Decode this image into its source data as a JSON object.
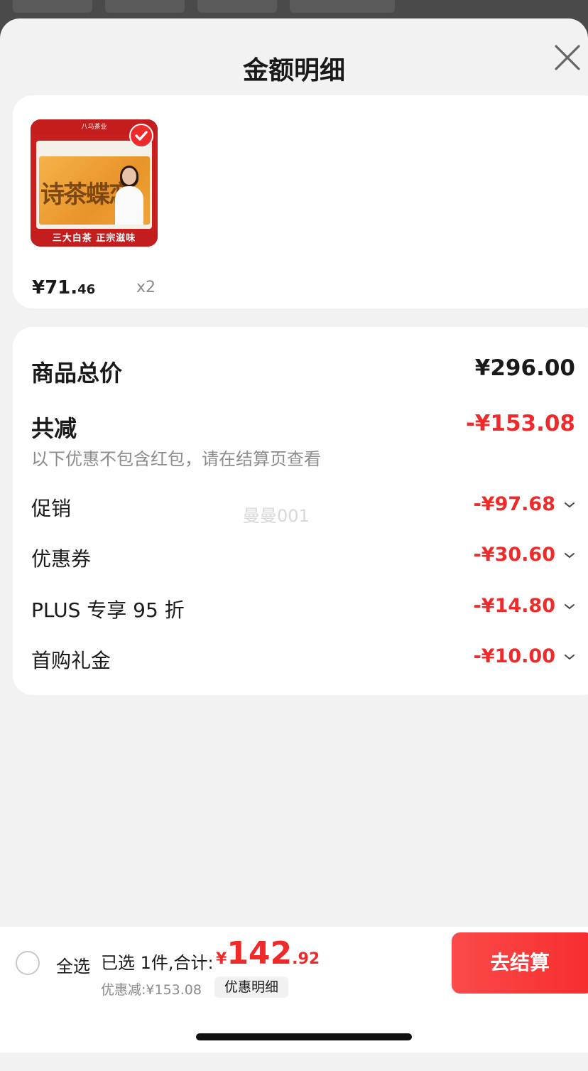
{
  "sheet": {
    "title": "金额明细"
  },
  "product": {
    "thumb_top_text": "八马茶业",
    "thumb_brush_text": "诗茶蝶恋",
    "thumb_bottom_text": "三大白茶  正宗滋味",
    "price_int": "¥71.",
    "price_cents": "46",
    "quantity": "x2"
  },
  "summary": {
    "total_label": "商品总价",
    "total_value": "¥296.00",
    "reduce_label": "共减",
    "reduce_value": "-¥153.08",
    "note": "以下优惠不包含红包，请在结算页查看",
    "watermark": "曼曼001",
    "discounts": [
      {
        "label": "促销",
        "value": "-¥97.68"
      },
      {
        "label": "优惠券",
        "value": "-¥30.60"
      },
      {
        "label": "PLUS 专享 95 折",
        "value": "-¥14.80"
      },
      {
        "label": "首购礼金",
        "value": "-¥10.00"
      }
    ]
  },
  "footer": {
    "select_all": "全选",
    "selected_text": "已选 1件,合计:",
    "total_yen": "¥",
    "total_int": "142",
    "total_dec": ".92",
    "saved": "优惠减:¥153.08",
    "detail_chip": "优惠明细",
    "checkout": "去结算"
  },
  "colors": {
    "accent_red": "#ee2a2a",
    "sheet_bg": "#f2f2f2",
    "card_bg": "#ffffff"
  }
}
